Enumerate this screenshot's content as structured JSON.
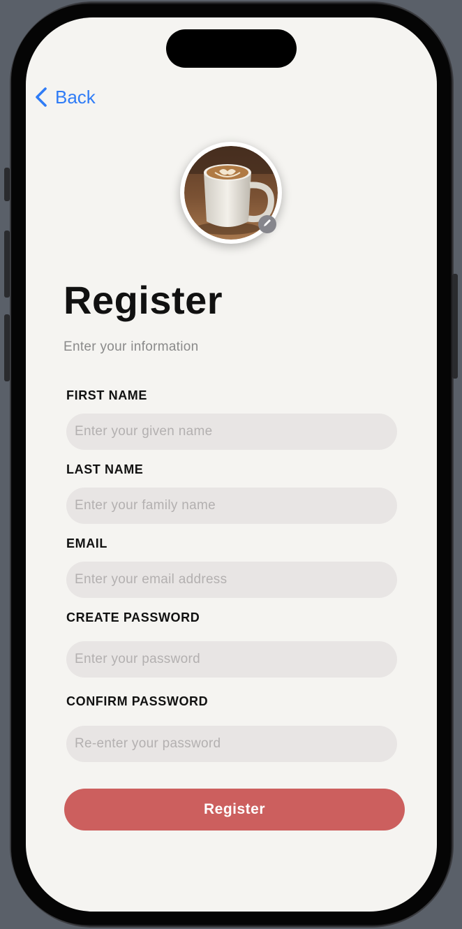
{
  "nav": {
    "back_label": "Back"
  },
  "profile": {
    "avatar_icon": "coffee-cup-photo",
    "edit_icon": "pencil-icon"
  },
  "header": {
    "title": "Register",
    "subtitle": "Enter your information"
  },
  "form": {
    "first_name": {
      "label": "FIRST NAME",
      "placeholder": "Enter your given name",
      "value": ""
    },
    "last_name": {
      "label": "LAST NAME",
      "placeholder": "Enter your family name",
      "value": ""
    },
    "email": {
      "label": "EMAIL",
      "placeholder": "Enter your email address",
      "value": ""
    },
    "create_password": {
      "label": "CREATE PASSWORD",
      "placeholder": "Enter your password",
      "value": ""
    },
    "confirm_password": {
      "label": "CONFIRM PASSWORD",
      "placeholder": "Re-enter your password",
      "value": ""
    },
    "submit_label": "Register"
  },
  "colors": {
    "accent_blue": "#2f7cf6",
    "button_red": "#cc5f5e",
    "input_bg": "#e8e5e4",
    "screen_bg": "#f5f4f1"
  }
}
